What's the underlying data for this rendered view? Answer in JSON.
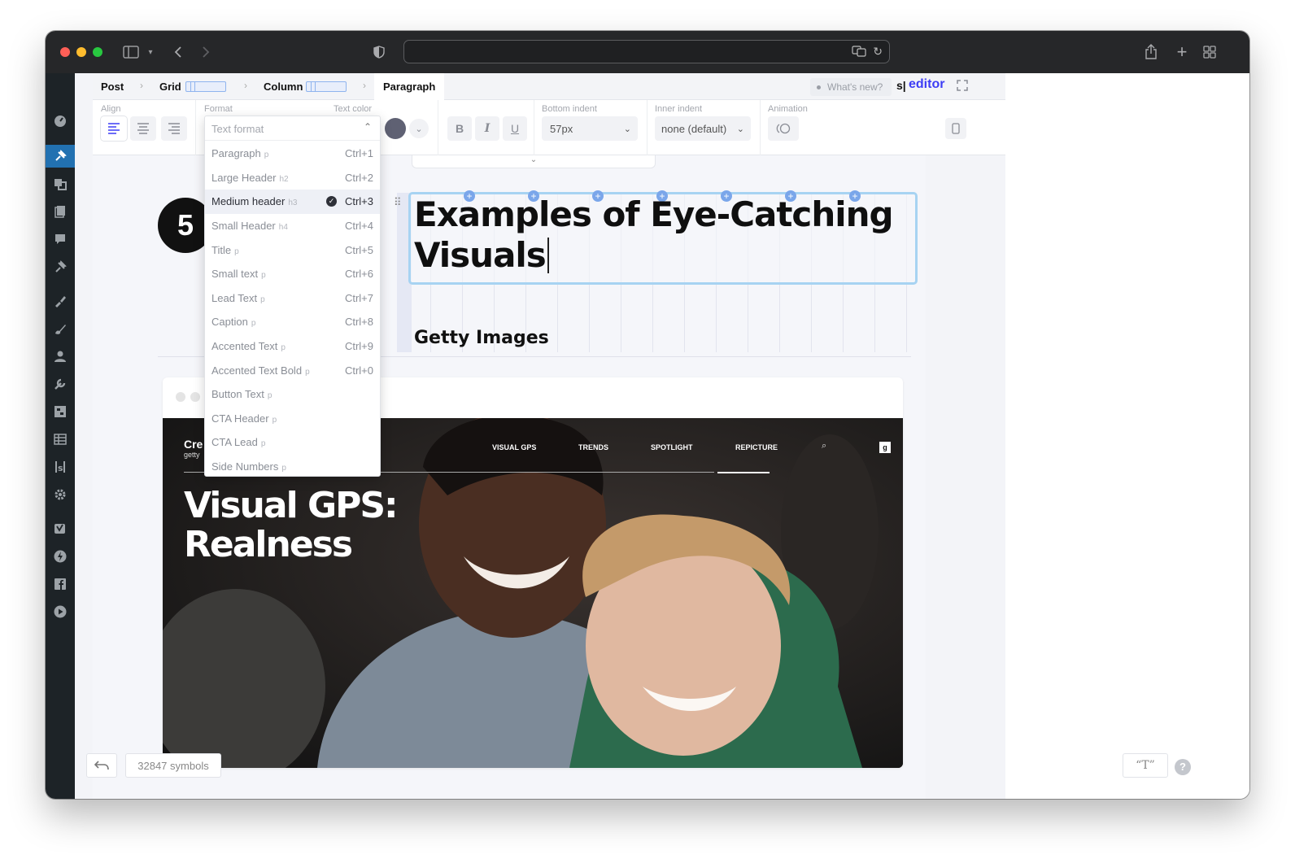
{
  "breadcrumb": {
    "post": "Post",
    "grid": "Grid",
    "column": "Column",
    "paragraph": "Paragraph"
  },
  "header_right": {
    "whats_new": "What's new?",
    "brand_prefix": "s|",
    "brand": "editor"
  },
  "toolbar": {
    "align_label": "Align",
    "format_label": "Format",
    "text_color_label": "Text color",
    "format_placeholder": "Text format",
    "bottom_indent_label": "Bottom indent",
    "bottom_indent_value": "57px",
    "inner_indent_label": "Inner indent",
    "inner_indent_value": "none (default)",
    "animation_label": "Animation",
    "bold": "B",
    "italic": "I",
    "underline": "U",
    "text_color": "#5f6173"
  },
  "format_menu": [
    {
      "label": "Paragraph",
      "tag": "p",
      "shortcut": "Ctrl+1"
    },
    {
      "label": "Large Header",
      "tag": "h2",
      "shortcut": "Ctrl+2"
    },
    {
      "label": "Medium header",
      "tag": "h3",
      "shortcut": "Ctrl+3",
      "selected": true
    },
    {
      "label": "Small Header",
      "tag": "h4",
      "shortcut": "Ctrl+4"
    },
    {
      "label": "Title",
      "tag": "p",
      "shortcut": "Ctrl+5"
    },
    {
      "label": "Small text",
      "tag": "p",
      "shortcut": "Ctrl+6"
    },
    {
      "label": "Lead Text",
      "tag": "p",
      "shortcut": "Ctrl+7"
    },
    {
      "label": "Caption",
      "tag": "p",
      "shortcut": "Ctrl+8"
    },
    {
      "label": "Accented Text",
      "tag": "p",
      "shortcut": "Ctrl+9"
    },
    {
      "label": "Accented Text Bold",
      "tag": "p",
      "shortcut": "Ctrl+0"
    },
    {
      "label": "Button Text",
      "tag": "p",
      "shortcut": ""
    },
    {
      "label": "CTA Header",
      "tag": "p",
      "shortcut": ""
    },
    {
      "label": "CTA Lead",
      "tag": "p",
      "shortcut": ""
    },
    {
      "label": "Side Numbers",
      "tag": "p",
      "shortcut": ""
    }
  ],
  "content": {
    "step_number": "5",
    "heading_line1": "Examples of Eye-Catching",
    "heading_line2": "Visuals",
    "subheading": "Getty Images"
  },
  "screenshot": {
    "logo": "Cre",
    "logo_sub": "getty",
    "nav": [
      "VISUAL GPS",
      "TRENDS",
      "SPOTLIGHT",
      "REPICTURE"
    ],
    "hero_line1": "Visual GPS:",
    "hero_line2": "Realness",
    "g_badge": "g"
  },
  "footer": {
    "symbols": "32847 symbols",
    "typography_chip": "“T”",
    "help": "?"
  },
  "colors": {
    "accent": "#3d3df5",
    "wp_active": "#2271b1",
    "selection_border": "#a7d3f2"
  }
}
